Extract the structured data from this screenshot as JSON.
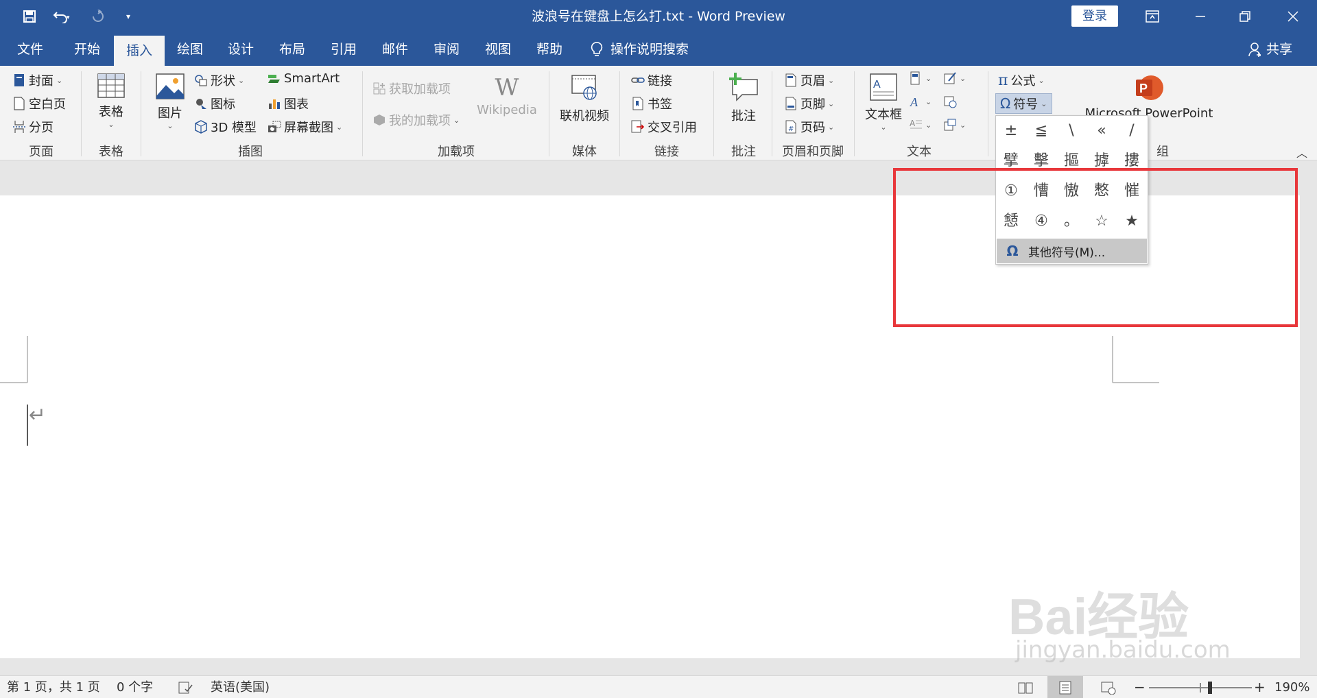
{
  "titlebar": {
    "title": "波浪号在键盘上怎么打.txt  -  Word Preview",
    "signin": "登录",
    "icons": [
      "save-icon",
      "undo-icon",
      "redo-icon",
      "customize-quick-access-icon",
      "ribbon-display-options-icon",
      "minimize-icon",
      "restore-icon",
      "close-icon"
    ]
  },
  "tabs": [
    {
      "label": "文件"
    },
    {
      "label": "开始"
    },
    {
      "label": "插入"
    },
    {
      "label": "绘图"
    },
    {
      "label": "设计"
    },
    {
      "label": "布局"
    },
    {
      "label": "引用"
    },
    {
      "label": "邮件"
    },
    {
      "label": "审阅"
    },
    {
      "label": "视图"
    },
    {
      "label": "帮助"
    }
  ],
  "active_tab": "插入",
  "search_hint": "操作说明搜索",
  "share": "共享",
  "ribbon": {
    "pages": {
      "cover": "封面",
      "blank": "空白页",
      "break": "分页",
      "label": "页面"
    },
    "tables": {
      "table": "表格",
      "label": "表格"
    },
    "illustrations": {
      "pictures": "图片",
      "shapes": "形状",
      "icons": "图标",
      "model3d": "3D 模型",
      "smartart": "SmartArt",
      "chart": "图表",
      "screenshot": "屏幕截图",
      "label": "插图"
    },
    "addins": {
      "get": "获取加载项",
      "my": "我的加载项",
      "wikipedia": "Wikipedia",
      "label": "加载项"
    },
    "media": {
      "video": "联机视频",
      "label": "媒体"
    },
    "links": {
      "link": "链接",
      "bookmark": "书签",
      "crossref": "交叉引用",
      "label": "链接"
    },
    "comments": {
      "comment": "批注",
      "label": "批注"
    },
    "header_footer": {
      "header": "页眉",
      "footer": "页脚",
      "page_number": "页码",
      "label": "页眉和页脚"
    },
    "text": {
      "textbox": "文本框",
      "label": "文本"
    },
    "symbols": {
      "equation": "公式",
      "symbol": "符号",
      "label_partial": "组"
    },
    "powerpoint": {
      "label": "Microsoft PowerPoint"
    }
  },
  "symbol_dropdown": {
    "symbols": [
      "±",
      "≦",
      "\\",
      "«",
      "/",
      "擘",
      "擊",
      "摳",
      "摢",
      "摟",
      "①",
      "慒",
      "慠",
      "慗",
      "慛",
      "懖",
      "④",
      "。",
      "☆",
      "★"
    ],
    "more": "其他符号(M)..."
  },
  "document": {
    "paragraph_mark": "↵"
  },
  "statusbar": {
    "page": "第 1 页，共 1 页",
    "words": "0 个字",
    "language": "英语(美国)",
    "zoom": "190%"
  },
  "watermark": {
    "brand": "Bai经验",
    "url": "jingyan.baidu.com"
  },
  "colors": {
    "brand": "#2b579a",
    "highlight": "#e8373b",
    "ribbon": "#f3f3f3"
  }
}
